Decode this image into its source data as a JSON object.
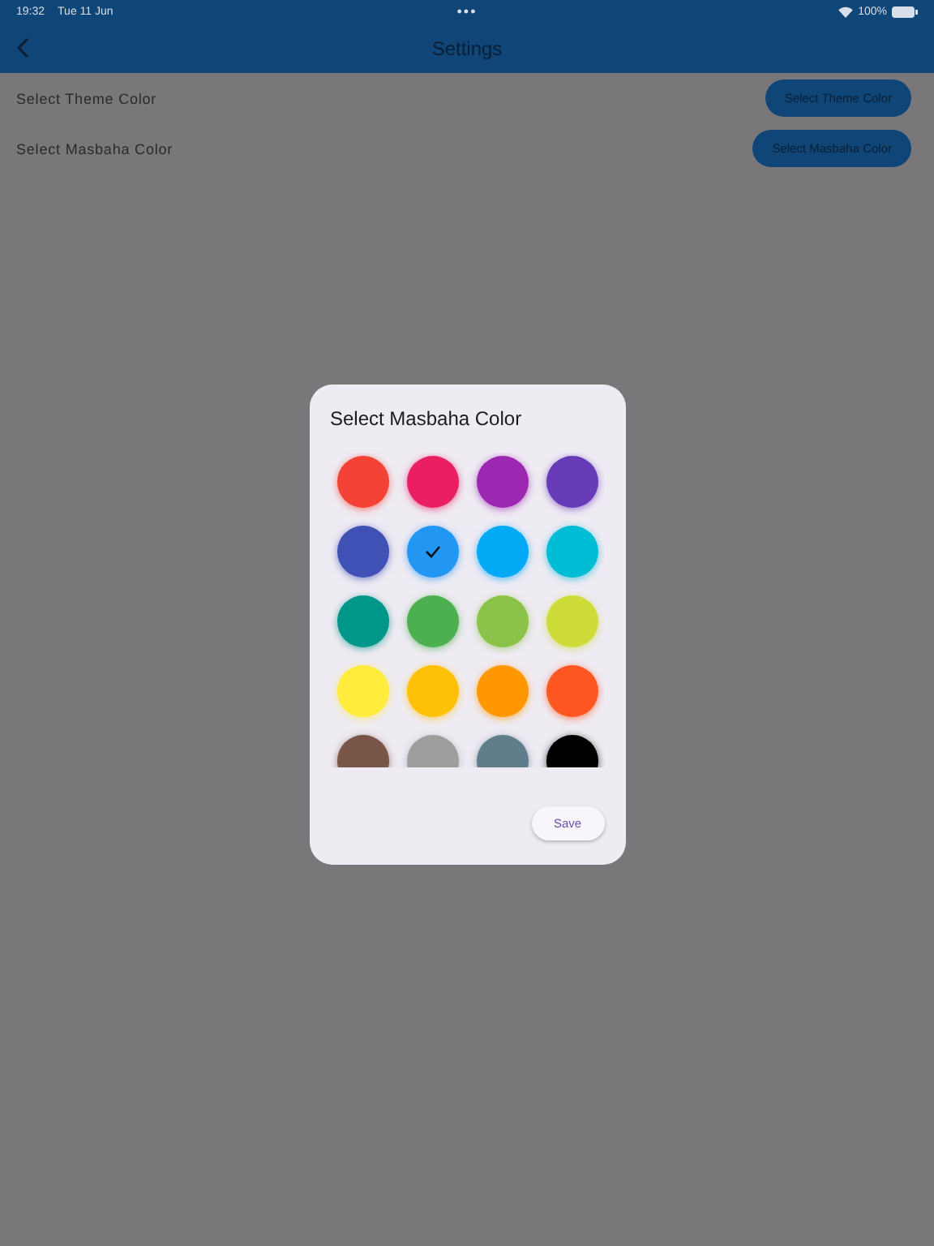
{
  "status_bar": {
    "time": "19:32",
    "date": "Tue 11 Jun",
    "dots": "•••",
    "battery": "100%"
  },
  "nav_bar": {
    "title": "Settings"
  },
  "settings": [
    {
      "label": "Select Theme Color",
      "button": "Select Theme Color"
    },
    {
      "label": "Select Masbaha Color",
      "button": "Select Masbaha Color"
    }
  ],
  "dialog": {
    "title": "Select Masbaha Color",
    "swatches": [
      {
        "color": "#f44336",
        "selected": false
      },
      {
        "color": "#e91e63",
        "selected": false
      },
      {
        "color": "#9c27b0",
        "selected": false
      },
      {
        "color": "#673ab7",
        "selected": false
      },
      {
        "color": "#3f51b5",
        "selected": false
      },
      {
        "color": "#2196f3",
        "selected": true
      },
      {
        "color": "#03a9f4",
        "selected": false
      },
      {
        "color": "#00bcd4",
        "selected": false
      },
      {
        "color": "#009688",
        "selected": false
      },
      {
        "color": "#4caf50",
        "selected": false
      },
      {
        "color": "#8bc34a",
        "selected": false
      },
      {
        "color": "#cddc39",
        "selected": false
      },
      {
        "color": "#ffeb3b",
        "selected": false
      },
      {
        "color": "#ffc107",
        "selected": false
      },
      {
        "color": "#ff9800",
        "selected": false
      },
      {
        "color": "#ff5722",
        "selected": false
      },
      {
        "color": "#795548",
        "selected": false
      },
      {
        "color": "#9e9e9e",
        "selected": false
      },
      {
        "color": "#607d8b",
        "selected": false
      },
      {
        "color": "#000000",
        "selected": false
      }
    ],
    "save_button": "Save"
  }
}
